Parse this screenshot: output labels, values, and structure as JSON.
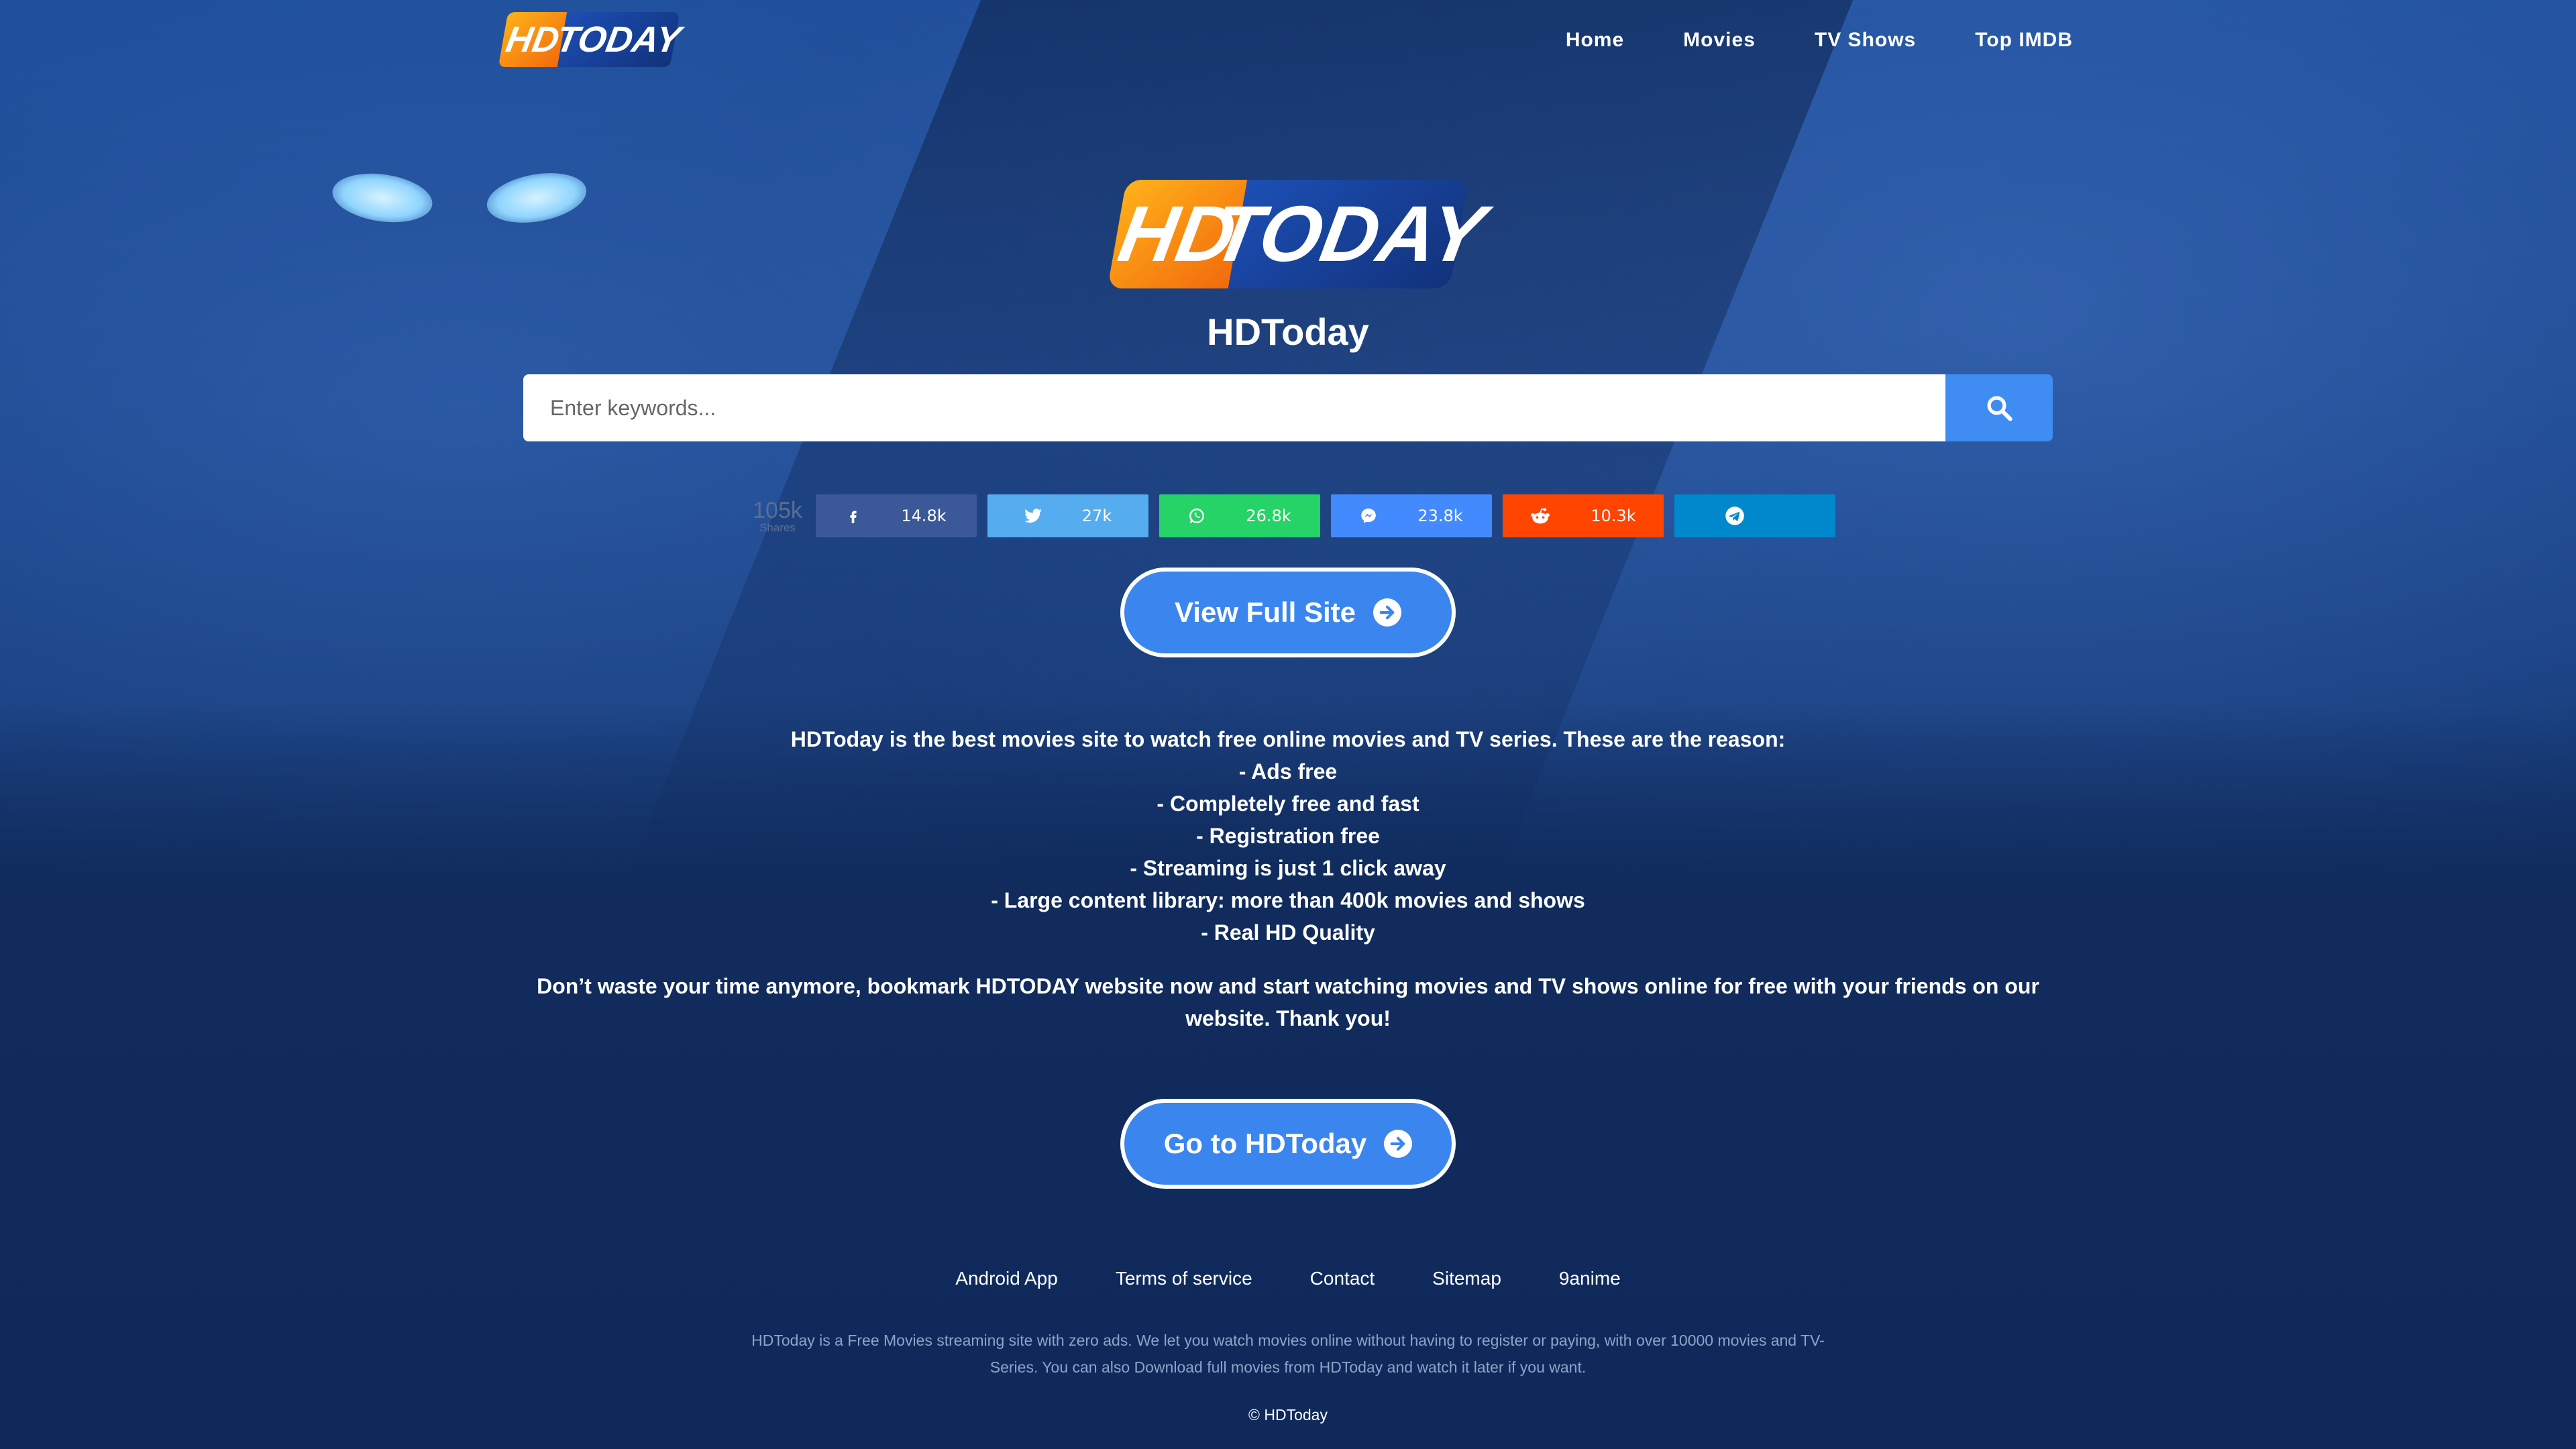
{
  "brand": {
    "hd": "HD",
    "today": "TODAY"
  },
  "nav": {
    "items": [
      "Home",
      "Movies",
      "TV Shows",
      "Top IMDB"
    ]
  },
  "hero": {
    "title": "HDToday"
  },
  "search": {
    "placeholder": "Enter keywords...",
    "value": ""
  },
  "share": {
    "total": "105k",
    "total_label": "Shares",
    "buttons": [
      {
        "network": "facebook",
        "count": "14.8k",
        "color": "#3b5998",
        "icon": "facebook-icon"
      },
      {
        "network": "twitter",
        "count": "27k",
        "color": "#55acee",
        "icon": "twitter-icon"
      },
      {
        "network": "whatsapp",
        "count": "26.8k",
        "color": "#25d366",
        "icon": "whatsapp-icon"
      },
      {
        "network": "messenger",
        "count": "23.8k",
        "color": "#448aff",
        "icon": "messenger-icon"
      },
      {
        "network": "reddit",
        "count": "10.3k",
        "color": "#ff4500",
        "icon": "reddit-icon"
      },
      {
        "network": "telegram",
        "count": "",
        "color": "#0088cc",
        "icon": "telegram-icon"
      }
    ]
  },
  "cta": {
    "view_full": "View Full Site",
    "go_to": "Go to HDToday"
  },
  "description": {
    "lines": [
      "HDToday is the best movies site to watch free online movies and TV series. These are the reason:",
      "- Ads free",
      "- Completely free and fast",
      "- Registration free",
      "- Streaming is just 1 click away",
      "- Large content library: more than 400k movies and shows",
      "- Real HD Quality"
    ],
    "outro": "Don’t waste your time anymore, bookmark HDTODAY website now and start watching movies and TV shows online for free with your friends on our website. Thank you!"
  },
  "footer": {
    "links": [
      "Android App",
      "Terms of service",
      "Contact",
      "Sitemap",
      "9anime"
    ],
    "text": "HDToday is a Free Movies streaming site with zero ads. We let you watch movies online without having to register or paying, with over 10000 movies and TV-Series. You can also Download full movies from HDToday and watch it later if you want.",
    "copyright": "© HDToday"
  },
  "colors": {
    "accent": "#3a86ee",
    "search_button": "#3f8cf2",
    "background": "#0f2f66",
    "logo_orange": "#f7931e",
    "logo_blue": "#1c4fb5"
  }
}
